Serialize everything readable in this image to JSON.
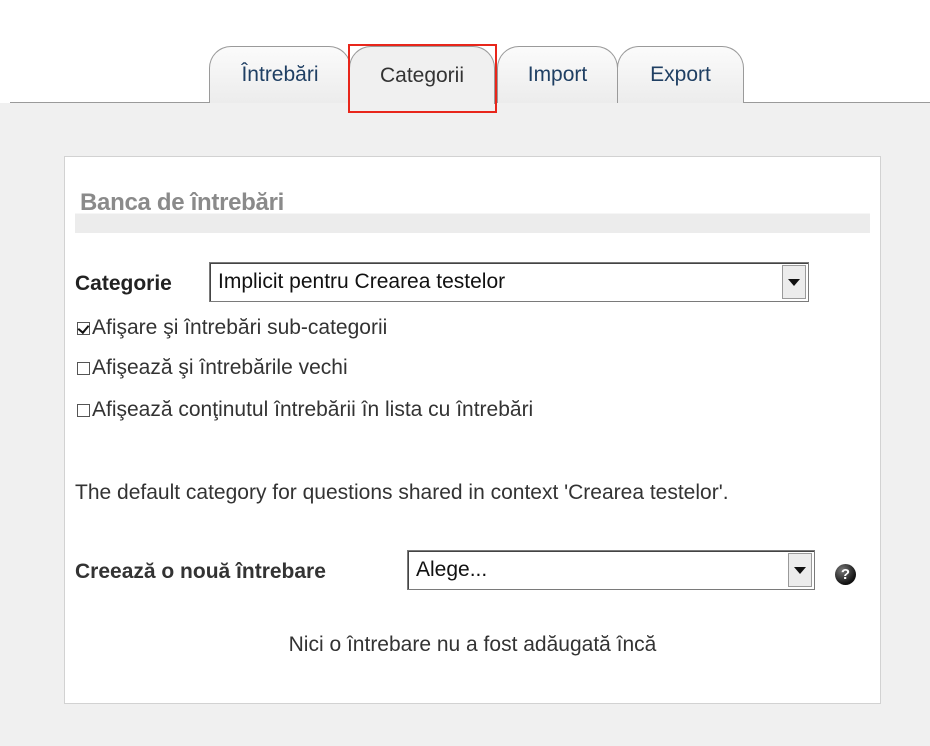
{
  "tabs": [
    {
      "label": "Întrebări"
    },
    {
      "label": "Categorii"
    },
    {
      "label": "Import"
    },
    {
      "label": "Export"
    }
  ],
  "active_tab": "Categorii",
  "colors": {
    "highlight": "#e8261b",
    "tab_text": "#1f3f63",
    "heading_text": "#8a8a8a"
  },
  "panel": {
    "heading": "Banca de întrebări",
    "category_label": "Categorie",
    "category_value": "Implicit pentru Crearea testelor",
    "options": [
      {
        "label": "Afişare şi întrebări sub-categorii",
        "checked": true
      },
      {
        "label": "Afişează şi întrebările vechi",
        "checked": false
      },
      {
        "label": "Afişează conţinutul întrebării în lista cu întrebări",
        "checked": false
      }
    ],
    "info_text": "The default category for questions shared in context 'Crearea testelor'.",
    "new_question_label": "Creează o nouă întrebare",
    "new_question_value": "Alege...",
    "help_icon": "question-mark-icon",
    "empty_message": "Nici o întrebare nu a fost adăugată încă"
  }
}
